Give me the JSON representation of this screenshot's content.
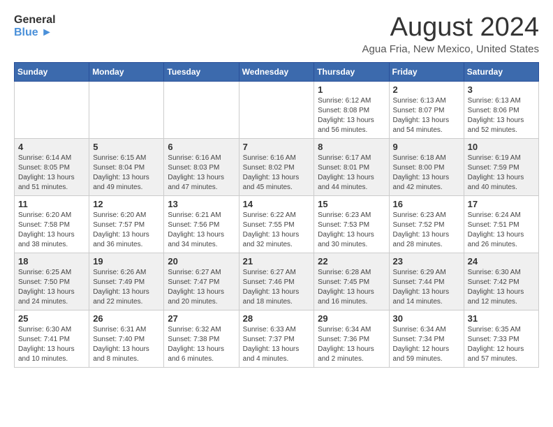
{
  "header": {
    "logo_text_top": "General",
    "logo_text_bottom": "Blue",
    "month_year": "August 2024",
    "location": "Agua Fria, New Mexico, United States"
  },
  "weekdays": [
    "Sunday",
    "Monday",
    "Tuesday",
    "Wednesday",
    "Thursday",
    "Friday",
    "Saturday"
  ],
  "weeks": [
    [
      {
        "day": "",
        "info": ""
      },
      {
        "day": "",
        "info": ""
      },
      {
        "day": "",
        "info": ""
      },
      {
        "day": "",
        "info": ""
      },
      {
        "day": "1",
        "info": "Sunrise: 6:12 AM\nSunset: 8:08 PM\nDaylight: 13 hours\nand 56 minutes."
      },
      {
        "day": "2",
        "info": "Sunrise: 6:13 AM\nSunset: 8:07 PM\nDaylight: 13 hours\nand 54 minutes."
      },
      {
        "day": "3",
        "info": "Sunrise: 6:13 AM\nSunset: 8:06 PM\nDaylight: 13 hours\nand 52 minutes."
      }
    ],
    [
      {
        "day": "4",
        "info": "Sunrise: 6:14 AM\nSunset: 8:05 PM\nDaylight: 13 hours\nand 51 minutes."
      },
      {
        "day": "5",
        "info": "Sunrise: 6:15 AM\nSunset: 8:04 PM\nDaylight: 13 hours\nand 49 minutes."
      },
      {
        "day": "6",
        "info": "Sunrise: 6:16 AM\nSunset: 8:03 PM\nDaylight: 13 hours\nand 47 minutes."
      },
      {
        "day": "7",
        "info": "Sunrise: 6:16 AM\nSunset: 8:02 PM\nDaylight: 13 hours\nand 45 minutes."
      },
      {
        "day": "8",
        "info": "Sunrise: 6:17 AM\nSunset: 8:01 PM\nDaylight: 13 hours\nand 44 minutes."
      },
      {
        "day": "9",
        "info": "Sunrise: 6:18 AM\nSunset: 8:00 PM\nDaylight: 13 hours\nand 42 minutes."
      },
      {
        "day": "10",
        "info": "Sunrise: 6:19 AM\nSunset: 7:59 PM\nDaylight: 13 hours\nand 40 minutes."
      }
    ],
    [
      {
        "day": "11",
        "info": "Sunrise: 6:20 AM\nSunset: 7:58 PM\nDaylight: 13 hours\nand 38 minutes."
      },
      {
        "day": "12",
        "info": "Sunrise: 6:20 AM\nSunset: 7:57 PM\nDaylight: 13 hours\nand 36 minutes."
      },
      {
        "day": "13",
        "info": "Sunrise: 6:21 AM\nSunset: 7:56 PM\nDaylight: 13 hours\nand 34 minutes."
      },
      {
        "day": "14",
        "info": "Sunrise: 6:22 AM\nSunset: 7:55 PM\nDaylight: 13 hours\nand 32 minutes."
      },
      {
        "day": "15",
        "info": "Sunrise: 6:23 AM\nSunset: 7:53 PM\nDaylight: 13 hours\nand 30 minutes."
      },
      {
        "day": "16",
        "info": "Sunrise: 6:23 AM\nSunset: 7:52 PM\nDaylight: 13 hours\nand 28 minutes."
      },
      {
        "day": "17",
        "info": "Sunrise: 6:24 AM\nSunset: 7:51 PM\nDaylight: 13 hours\nand 26 minutes."
      }
    ],
    [
      {
        "day": "18",
        "info": "Sunrise: 6:25 AM\nSunset: 7:50 PM\nDaylight: 13 hours\nand 24 minutes."
      },
      {
        "day": "19",
        "info": "Sunrise: 6:26 AM\nSunset: 7:49 PM\nDaylight: 13 hours\nand 22 minutes."
      },
      {
        "day": "20",
        "info": "Sunrise: 6:27 AM\nSunset: 7:47 PM\nDaylight: 13 hours\nand 20 minutes."
      },
      {
        "day": "21",
        "info": "Sunrise: 6:27 AM\nSunset: 7:46 PM\nDaylight: 13 hours\nand 18 minutes."
      },
      {
        "day": "22",
        "info": "Sunrise: 6:28 AM\nSunset: 7:45 PM\nDaylight: 13 hours\nand 16 minutes."
      },
      {
        "day": "23",
        "info": "Sunrise: 6:29 AM\nSunset: 7:44 PM\nDaylight: 13 hours\nand 14 minutes."
      },
      {
        "day": "24",
        "info": "Sunrise: 6:30 AM\nSunset: 7:42 PM\nDaylight: 13 hours\nand 12 minutes."
      }
    ],
    [
      {
        "day": "25",
        "info": "Sunrise: 6:30 AM\nSunset: 7:41 PM\nDaylight: 13 hours\nand 10 minutes."
      },
      {
        "day": "26",
        "info": "Sunrise: 6:31 AM\nSunset: 7:40 PM\nDaylight: 13 hours\nand 8 minutes."
      },
      {
        "day": "27",
        "info": "Sunrise: 6:32 AM\nSunset: 7:38 PM\nDaylight: 13 hours\nand 6 minutes."
      },
      {
        "day": "28",
        "info": "Sunrise: 6:33 AM\nSunset: 7:37 PM\nDaylight: 13 hours\nand 4 minutes."
      },
      {
        "day": "29",
        "info": "Sunrise: 6:34 AM\nSunset: 7:36 PM\nDaylight: 13 hours\nand 2 minutes."
      },
      {
        "day": "30",
        "info": "Sunrise: 6:34 AM\nSunset: 7:34 PM\nDaylight: 12 hours\nand 59 minutes."
      },
      {
        "day": "31",
        "info": "Sunrise: 6:35 AM\nSunset: 7:33 PM\nDaylight: 12 hours\nand 57 minutes."
      }
    ]
  ]
}
